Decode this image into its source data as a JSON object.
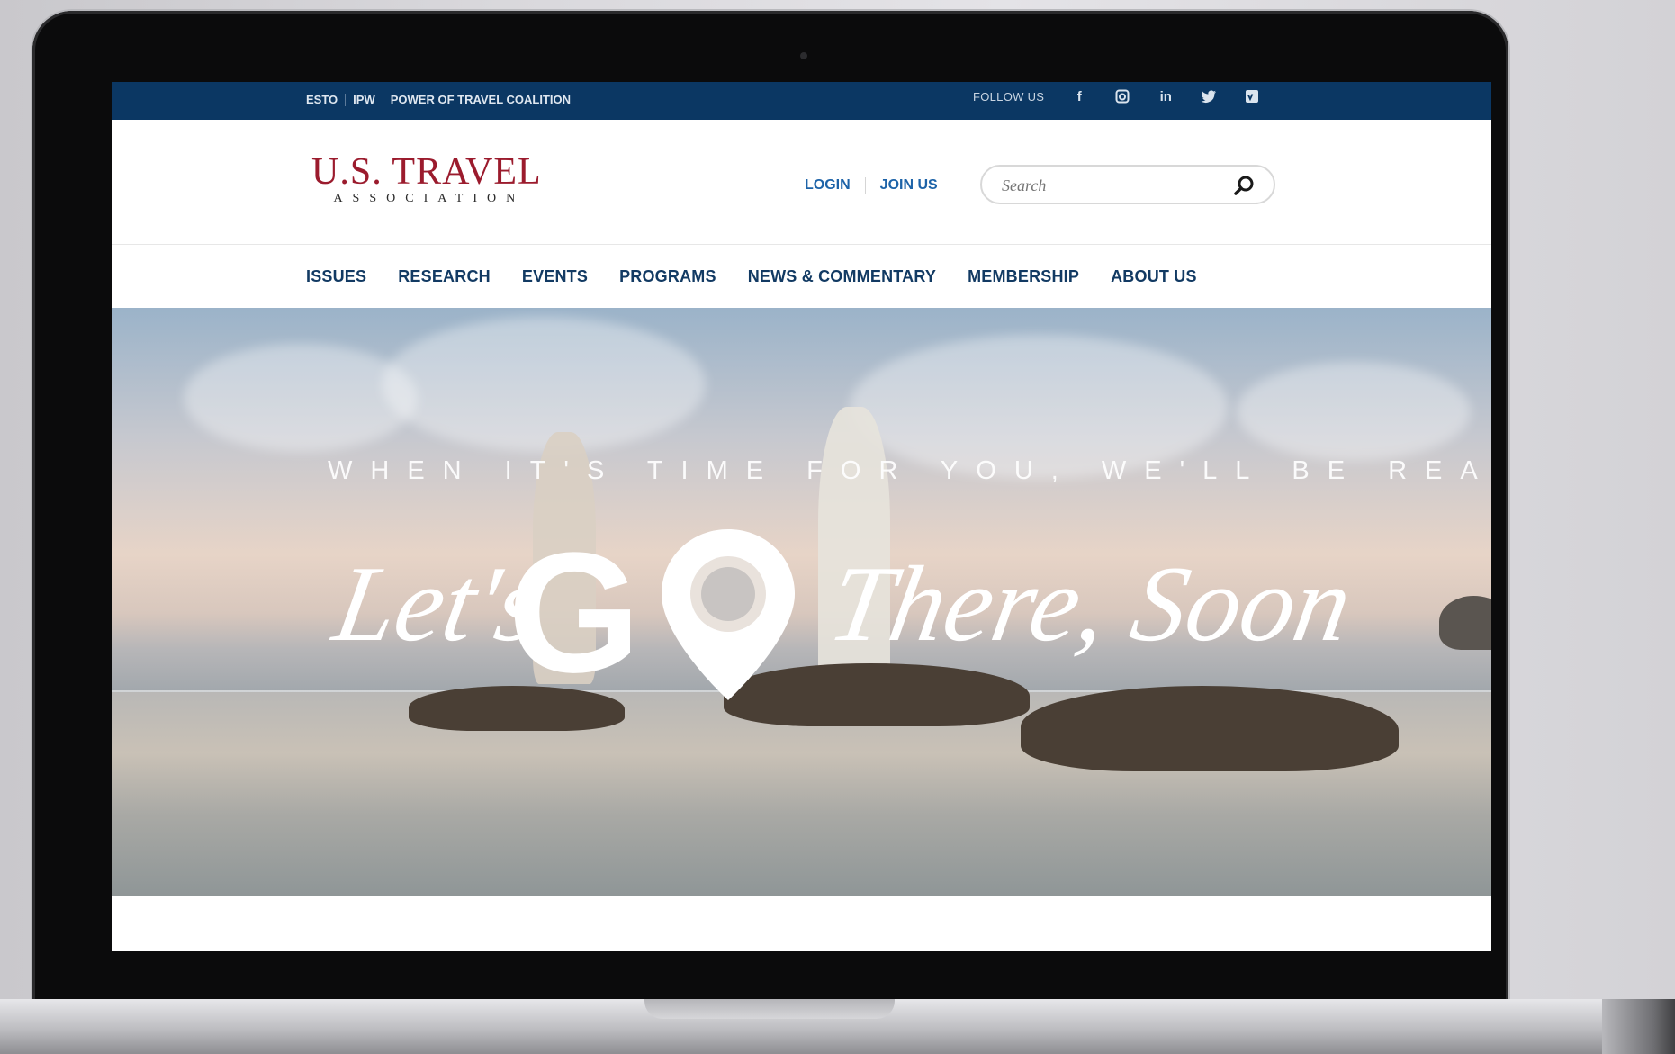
{
  "util_bar": {
    "links": [
      "ESTO",
      "IPW",
      "POWER OF TRAVEL COALITION"
    ],
    "follow_label": "FOLLOW US",
    "social": [
      "facebook-icon",
      "instagram-icon",
      "linkedin-icon",
      "twitter-icon",
      "vimeo-icon"
    ]
  },
  "header": {
    "logo_main": "U.S. TRAVEL",
    "logo_sub": "ASSOCIATION",
    "login": "LOGIN",
    "join": "JOIN US",
    "search_placeholder": "Search"
  },
  "nav": {
    "items": [
      "ISSUES",
      "RESEARCH",
      "EVENTS",
      "PROGRAMS",
      "NEWS & COMMENTARY",
      "MEMBERSHIP",
      "ABOUT US"
    ]
  },
  "hero": {
    "tagline": "WHEN IT'S TIME FOR YOU, WE'LL BE READY",
    "headline_lets": "Let's",
    "headline_go": "G",
    "headline_there": "There, Soon"
  },
  "colors": {
    "util_bar_bg": "#0b3763",
    "brand_red": "#9b1b2d",
    "link_blue": "#1d63a8",
    "nav_text": "#123a63"
  }
}
